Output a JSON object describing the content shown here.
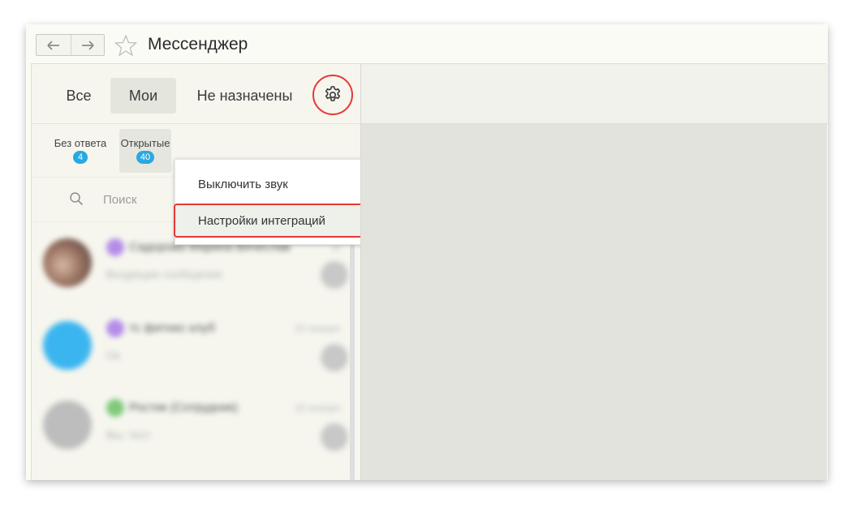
{
  "window": {
    "title": "Мессенджер",
    "back_icon": "arrow-left-icon",
    "forward_icon": "arrow-right-icon",
    "favorite_icon": "star-icon"
  },
  "tabs": [
    {
      "label": "Все",
      "active": false
    },
    {
      "label": "Мои",
      "active": true
    },
    {
      "label": "Не назначены",
      "active": false
    }
  ],
  "settings_icon": "gear-icon",
  "filters": [
    {
      "label": "Без ответа",
      "count": "4",
      "active": false
    },
    {
      "label": "Открытые",
      "count": "40",
      "active": true
    }
  ],
  "search": {
    "placeholder": "Поиск",
    "value": ""
  },
  "menu": {
    "items": [
      {
        "label": "Выключить звук",
        "highlighted": false
      },
      {
        "label": "Настройки интеграций",
        "highlighted": true
      }
    ]
  },
  "chats": [
    {
      "name": "Садорова Марина Вячеслав",
      "preview": "Входящее сообщение",
      "time": "вт",
      "avatar_color": "#8a6a5c",
      "channel_color": "#b48ce8"
    },
    {
      "name": "тс фитнес клуб",
      "preview": "Ок",
      "time": "20 января",
      "avatar_color": "#3bb5ef",
      "channel_color": "#b48ce8"
    },
    {
      "name": "Ростик (Сотрудник)",
      "preview": "Вы: тест",
      "time": "16 января",
      "avatar_color": "#bdbdbd",
      "channel_color": "#7fc97a"
    }
  ],
  "colors": {
    "highlight_outline": "#e53935",
    "badge": "#29a9e1",
    "right_panel": "#e1e3dc"
  }
}
